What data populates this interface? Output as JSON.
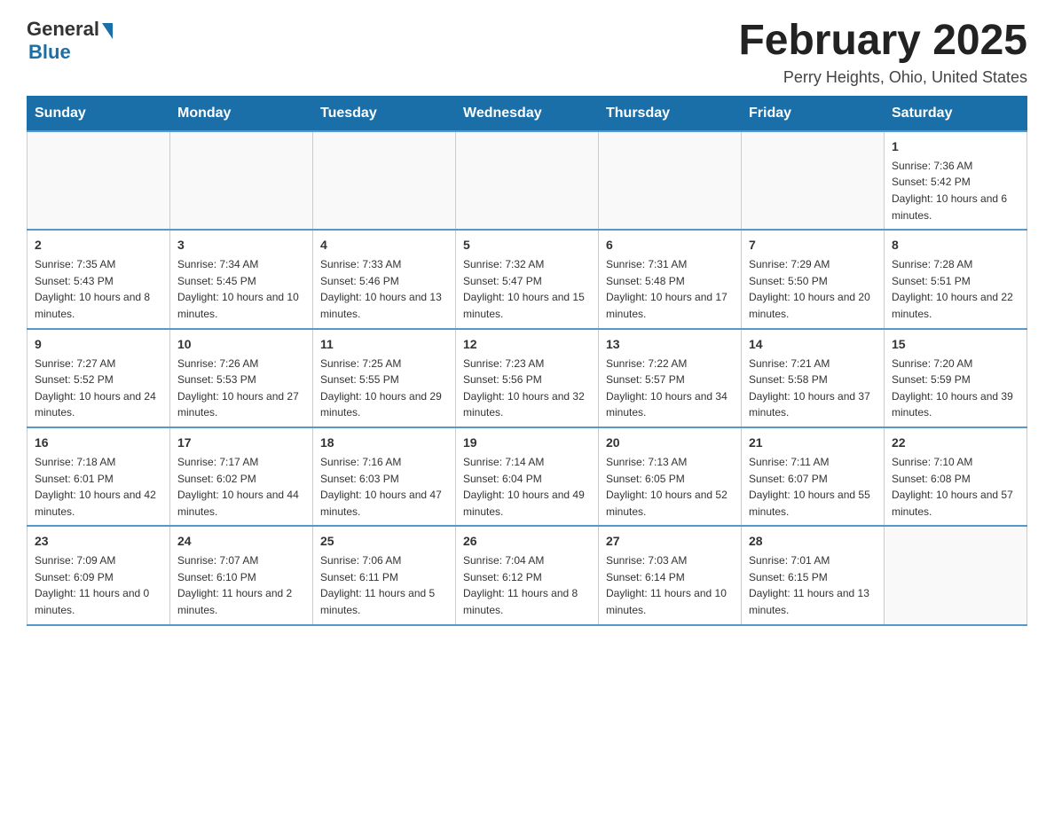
{
  "header": {
    "logo_general": "General",
    "logo_blue": "Blue",
    "month_title": "February 2025",
    "location": "Perry Heights, Ohio, United States"
  },
  "days_of_week": [
    "Sunday",
    "Monday",
    "Tuesday",
    "Wednesday",
    "Thursday",
    "Friday",
    "Saturday"
  ],
  "weeks": [
    [
      {
        "day": "",
        "info": ""
      },
      {
        "day": "",
        "info": ""
      },
      {
        "day": "",
        "info": ""
      },
      {
        "day": "",
        "info": ""
      },
      {
        "day": "",
        "info": ""
      },
      {
        "day": "",
        "info": ""
      },
      {
        "day": "1",
        "info": "Sunrise: 7:36 AM\nSunset: 5:42 PM\nDaylight: 10 hours and 6 minutes."
      }
    ],
    [
      {
        "day": "2",
        "info": "Sunrise: 7:35 AM\nSunset: 5:43 PM\nDaylight: 10 hours and 8 minutes."
      },
      {
        "day": "3",
        "info": "Sunrise: 7:34 AM\nSunset: 5:45 PM\nDaylight: 10 hours and 10 minutes."
      },
      {
        "day": "4",
        "info": "Sunrise: 7:33 AM\nSunset: 5:46 PM\nDaylight: 10 hours and 13 minutes."
      },
      {
        "day": "5",
        "info": "Sunrise: 7:32 AM\nSunset: 5:47 PM\nDaylight: 10 hours and 15 minutes."
      },
      {
        "day": "6",
        "info": "Sunrise: 7:31 AM\nSunset: 5:48 PM\nDaylight: 10 hours and 17 minutes."
      },
      {
        "day": "7",
        "info": "Sunrise: 7:29 AM\nSunset: 5:50 PM\nDaylight: 10 hours and 20 minutes."
      },
      {
        "day": "8",
        "info": "Sunrise: 7:28 AM\nSunset: 5:51 PM\nDaylight: 10 hours and 22 minutes."
      }
    ],
    [
      {
        "day": "9",
        "info": "Sunrise: 7:27 AM\nSunset: 5:52 PM\nDaylight: 10 hours and 24 minutes."
      },
      {
        "day": "10",
        "info": "Sunrise: 7:26 AM\nSunset: 5:53 PM\nDaylight: 10 hours and 27 minutes."
      },
      {
        "day": "11",
        "info": "Sunrise: 7:25 AM\nSunset: 5:55 PM\nDaylight: 10 hours and 29 minutes."
      },
      {
        "day": "12",
        "info": "Sunrise: 7:23 AM\nSunset: 5:56 PM\nDaylight: 10 hours and 32 minutes."
      },
      {
        "day": "13",
        "info": "Sunrise: 7:22 AM\nSunset: 5:57 PM\nDaylight: 10 hours and 34 minutes."
      },
      {
        "day": "14",
        "info": "Sunrise: 7:21 AM\nSunset: 5:58 PM\nDaylight: 10 hours and 37 minutes."
      },
      {
        "day": "15",
        "info": "Sunrise: 7:20 AM\nSunset: 5:59 PM\nDaylight: 10 hours and 39 minutes."
      }
    ],
    [
      {
        "day": "16",
        "info": "Sunrise: 7:18 AM\nSunset: 6:01 PM\nDaylight: 10 hours and 42 minutes."
      },
      {
        "day": "17",
        "info": "Sunrise: 7:17 AM\nSunset: 6:02 PM\nDaylight: 10 hours and 44 minutes."
      },
      {
        "day": "18",
        "info": "Sunrise: 7:16 AM\nSunset: 6:03 PM\nDaylight: 10 hours and 47 minutes."
      },
      {
        "day": "19",
        "info": "Sunrise: 7:14 AM\nSunset: 6:04 PM\nDaylight: 10 hours and 49 minutes."
      },
      {
        "day": "20",
        "info": "Sunrise: 7:13 AM\nSunset: 6:05 PM\nDaylight: 10 hours and 52 minutes."
      },
      {
        "day": "21",
        "info": "Sunrise: 7:11 AM\nSunset: 6:07 PM\nDaylight: 10 hours and 55 minutes."
      },
      {
        "day": "22",
        "info": "Sunrise: 7:10 AM\nSunset: 6:08 PM\nDaylight: 10 hours and 57 minutes."
      }
    ],
    [
      {
        "day": "23",
        "info": "Sunrise: 7:09 AM\nSunset: 6:09 PM\nDaylight: 11 hours and 0 minutes."
      },
      {
        "day": "24",
        "info": "Sunrise: 7:07 AM\nSunset: 6:10 PM\nDaylight: 11 hours and 2 minutes."
      },
      {
        "day": "25",
        "info": "Sunrise: 7:06 AM\nSunset: 6:11 PM\nDaylight: 11 hours and 5 minutes."
      },
      {
        "day": "26",
        "info": "Sunrise: 7:04 AM\nSunset: 6:12 PM\nDaylight: 11 hours and 8 minutes."
      },
      {
        "day": "27",
        "info": "Sunrise: 7:03 AM\nSunset: 6:14 PM\nDaylight: 11 hours and 10 minutes."
      },
      {
        "day": "28",
        "info": "Sunrise: 7:01 AM\nSunset: 6:15 PM\nDaylight: 11 hours and 13 minutes."
      },
      {
        "day": "",
        "info": ""
      }
    ]
  ]
}
